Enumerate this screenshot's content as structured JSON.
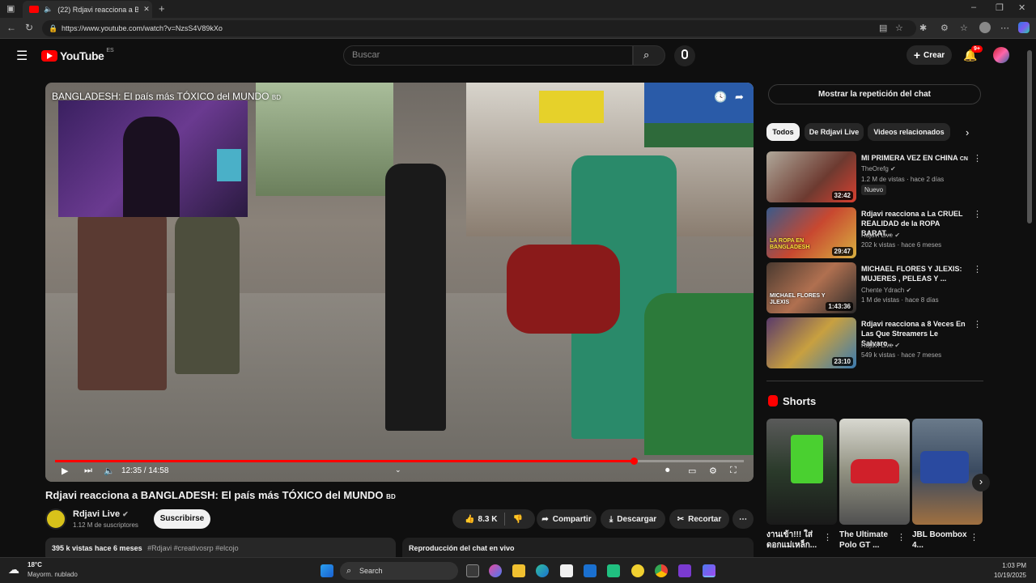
{
  "browser": {
    "tab_title": "(22) Rdjavi reacciona a BAN",
    "url": "https://www.youtube.com/watch?v=NzsS4V89kXo"
  },
  "header": {
    "logo_text": "YouTube",
    "country_code": "ES",
    "search_placeholder": "Buscar",
    "create_label": "Crear",
    "notification_count": "9+"
  },
  "video": {
    "overlay_title": "BANGLADESH: El país más TÓXICO del MUNDO",
    "overlay_flag": "BD",
    "time": "12:35 / 14:58",
    "progress_fraction": 0.84
  },
  "details": {
    "title": "Rdjavi reacciona a BANGLADESH: El país más TÓXICO del MUNDO",
    "title_flag": "BD",
    "channel": "Rdjavi Live",
    "subscribers": "1.12 M de suscriptores",
    "subscribe_label": "Suscribirse",
    "likes": "8.3 K",
    "share_label": "Compartir",
    "download_label": "Descargar",
    "clip_label": "Recortar",
    "views_date": "395 k vistas  hace 6 meses",
    "hashtags": "#Rdjavi #creativosrp #elcojo",
    "chat_replay_label": "Reproducción del chat en vivo"
  },
  "sidebar": {
    "show_chat_label": "Mostrar la repetición del chat",
    "chips": [
      "Todos",
      "De Rdjavi Live",
      "Videos relacionados"
    ],
    "recommendations": [
      {
        "title": "MI PRIMERA VEZ EN CHINA",
        "flag": "CN",
        "channel": "TheOrefg",
        "meta": "1.2 M de vistas · hace 2 días",
        "duration": "32:42",
        "badge": "Nuevo"
      },
      {
        "title": "Rdjavi reacciona a La CRUEL REALIDAD de la ROPA BARAT...",
        "channel": "Rdjavi Live",
        "meta": "202 k vistas · hace 6 meses",
        "duration": "29:47",
        "thumb_text": "LA ROPA EN BANGLADESH"
      },
      {
        "title": "MICHAEL FLORES Y JLEXIS: MUJERES , PELEAS Y ...",
        "channel": "Chente Ydrach",
        "meta": "1 M de vistas · hace 8 días",
        "duration": "1:43:36",
        "thumb_text": "MICHAEL FLORES Y JLEXIS"
      },
      {
        "title": "Rdjavi reacciona a  8 Veces En Las Que Streamers Le Salvaro...",
        "channel": "Rdjavi Live",
        "meta": "549 k vistas · hace 7 meses",
        "duration": "23:10"
      }
    ],
    "shorts_label": "Shorts",
    "shorts": [
      {
        "title": "งานเข้า!!! ใส่ ดอกแม่เหล็ก..."
      },
      {
        "title": "The Ultimate Polo GT ..."
      },
      {
        "title": "JBL Boombox 4..."
      }
    ]
  },
  "taskbar": {
    "temperature": "18°C",
    "weather": "Mayorm. nublado",
    "search_label": "Search",
    "time": "1:03 PM",
    "date": "10/19/2025"
  },
  "colors": {
    "accent_red": "#ff0000",
    "background": "#0f0f0f"
  }
}
